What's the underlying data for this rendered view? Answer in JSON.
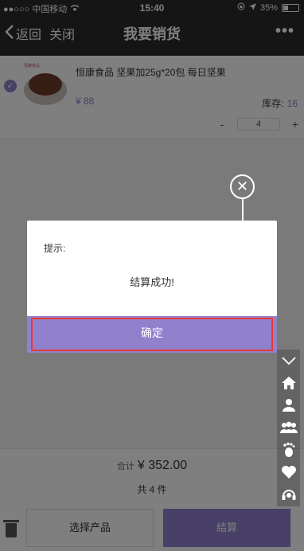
{
  "status_bar": {
    "carrier": "●●○○○ 中国移动",
    "time": "15:40",
    "battery": "35%",
    "battery_level": 0.35
  },
  "nav": {
    "back_label": "返回",
    "close_label": "关闭",
    "title": "我要销货",
    "more": "•••"
  },
  "product": {
    "checked": true,
    "brand_text": "恒康食品",
    "name": "恒康食品 坚果加25g*20包 每日坚果",
    "price": "¥ 88",
    "stock_label": "库存:",
    "stock_value": "16",
    "qty_minus": "-",
    "quantity": "4",
    "qty_plus": "+"
  },
  "summary": {
    "total_label": "合计",
    "total_amount": "¥ 352.00",
    "count": "共 4 件"
  },
  "bottom": {
    "select_label": "选择产品",
    "checkout_label": "结算"
  },
  "dialog": {
    "tip_label": "提示:",
    "message": "结算成功!",
    "ok_label": "确定",
    "close_glyph": "✕"
  },
  "side_toolbar": {
    "icons": [
      "chevron-down-icon",
      "home-icon",
      "user-icon",
      "group-icon",
      "footprint-icon",
      "heart-icon",
      "headset-icon"
    ]
  },
  "colors": {
    "accent": "#9181cc",
    "highlight": "#e53935",
    "nav_bg": "#2b2b2b"
  }
}
